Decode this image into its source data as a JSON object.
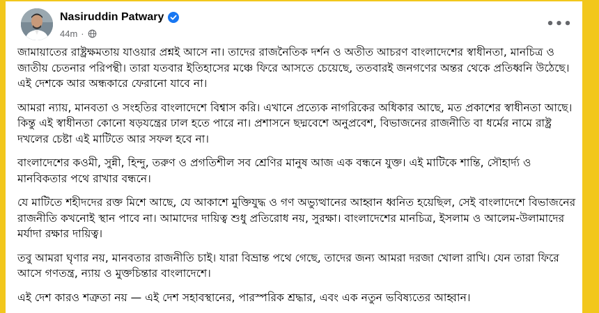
{
  "post": {
    "author_name": "Nasiruddin Patwary",
    "timestamp": "44m",
    "separator": "·",
    "more_label": "•••",
    "paragraphs": [
      "জামায়াতের রাষ্ট্রক্ষমতায় যাওয়ার প্রশ্নই আসে না। তাদের রাজনৈতিক দর্শন ও অতীত আচরণ বাংলাদেশের স্বাধীনতা, মানচিত্র ও জাতীয় চেতনার পরিপন্থী। তারা যতবার ইতিহাসের মঞ্চে ফিরে আসতে চেয়েছে, ততবারই জনগণের অন্তর থেকে প্রতিধ্বনি উঠেছে। এই দেশকে আর অন্ধকারে ফেরানো যাবে না।",
      "আমরা ন্যায়, মানবতা ও সংহতির বাংলাদেশে বিশ্বাস করি। এখানে প্রত্যেক নাগরিকের অধিকার আছে, মত প্রকাশের স্বাধীনতা আছে। কিন্তু এই স্বাধীনতা কোনো ষড়যন্ত্রের ঢাল হতে পারে না। প্রশাসনে ছদ্মবেশে অনুপ্রবেশ, বিভাজনের রাজনীতি বা ধর্মের নামে রাষ্ট্র দখলের চেষ্টা এই মাটিতে আর সফল হবে না।",
      "বাংলাদেশের কওমী, সুন্নী, হিন্দু, তরুণ ও প্রগতিশীল সব শ্রেণির মানুষ আজ এক বন্ধনে যুক্ত। এই মাটিকে শান্তি, সৌহার্দ্য ও মানবিকতার পথে রাখার বন্ধনে।",
      "যে মাটিতে শহীদদের রক্ত মিশে আছে, যে আকাশে মুক্তিযুদ্ধ ও গণ অভ্যুত্থানের আহ্বান ধ্বনিত হয়েছিল, সেই বাংলাদেশে বিভাজনের রাজনীতি কখনোই স্থান পাবে না। আমাদের দায়িত্ব শুধু প্রতিরোধ নয়, সুরক্ষা। বাংলাদেশের মানচিত্র, ইসলাম ও আলেম-উলামাদের মর্যাদা রক্ষার দায়িত্ব।",
      "তবু আমরা ঘৃণার নয়, মানবতার রাজনীতি চাই। যারা বিভ্রান্ত পথে গেছে, তাদের জন্য আমরা দরজা খোলা রাখি। যেন তারা ফিরে আসে গণতন্ত্র, ন্যায় ও মুক্তচিন্তার বাংলাদেশে।",
      "এই দেশ কারও শত্রুতা নয় — এই দেশ সহাবস্থানের, পারস্পরিক শ্রদ্ধার, এবং এক নতুন ভবিষ্যতের আহ্বান।"
    ]
  },
  "icons": {
    "verified": "verified-badge-icon",
    "audience": "globe-icon",
    "more": "more-options-icon"
  },
  "colors": {
    "frame": "#f2c71c",
    "verified": "#1877f2",
    "meta_text": "#65676b",
    "text": "#050505"
  }
}
